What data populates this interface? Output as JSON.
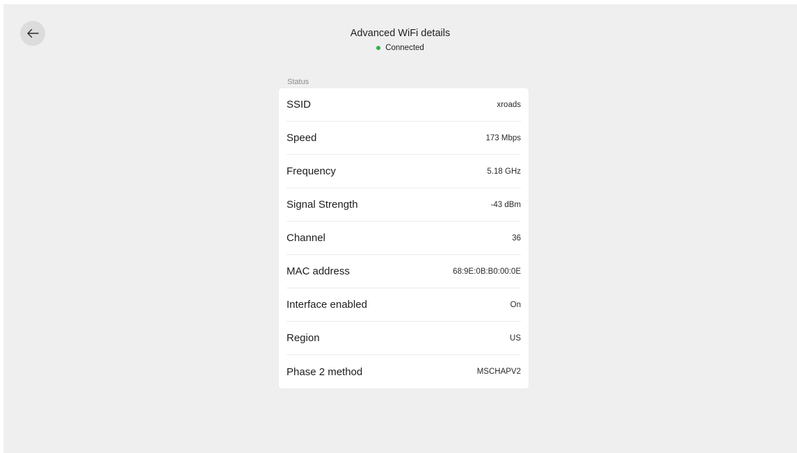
{
  "header": {
    "title": "Advanced WiFi details",
    "status": "Connected",
    "status_color": "#2bb24c"
  },
  "nav": {
    "back_icon": "arrow-left-icon"
  },
  "section": {
    "label": "Status"
  },
  "rows": [
    {
      "label": "SSID",
      "value": "xroads"
    },
    {
      "label": "Speed",
      "value": "173 Mbps"
    },
    {
      "label": "Frequency",
      "value": "5.18 GHz"
    },
    {
      "label": "Signal Strength",
      "value": "-43 dBm"
    },
    {
      "label": "Channel",
      "value": "36"
    },
    {
      "label": "MAC address",
      "value": "68:9E:0B:B0:00:0E"
    },
    {
      "label": "Interface enabled",
      "value": "On"
    },
    {
      "label": "Region",
      "value": "US"
    },
    {
      "label": "Phase 2 method",
      "value": "MSCHAPV2"
    }
  ]
}
